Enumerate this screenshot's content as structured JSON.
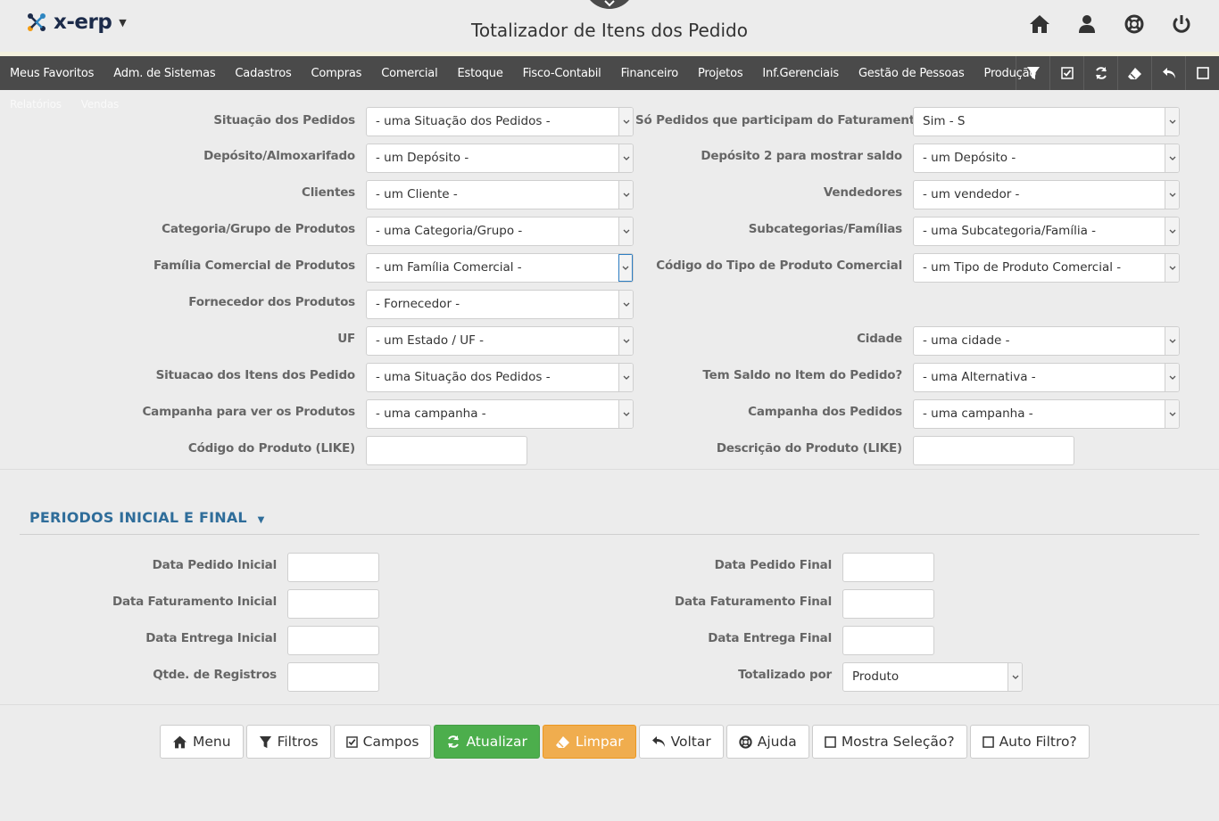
{
  "app": {
    "logo_text": "x-erp",
    "title": "Totalizador de Itens dos Pedido"
  },
  "header_icons": [
    "home-icon",
    "user-icon",
    "help-lifebuoy-icon",
    "power-icon"
  ],
  "menu": {
    "items": [
      "Meus Favoritos",
      "Adm. de Sistemas",
      "Cadastros",
      "Compras",
      "Comercial",
      "Estoque",
      "Fisco-Contabil",
      "Financeiro",
      "Projetos",
      "Inf.Gerenciais",
      "Gestão de Pessoas",
      "Produção"
    ],
    "row2": [
      "Relatórios",
      "Vendas"
    ],
    "tools": [
      "filter-icon",
      "checkbox-icon",
      "refresh-icon",
      "eraser-icon",
      "undo-icon",
      "square-icon"
    ]
  },
  "filters": {
    "situacao_pedidos": {
      "label": "Situação dos Pedidos",
      "value": "- uma Situação dos Pedidos -"
    },
    "so_pedidos_faturamento": {
      "label": "Só Pedidos que participam do Faturamento?",
      "value": "Sim - S"
    },
    "deposito": {
      "label": "Depósito/Almoxarifado",
      "value": "- um Depósito -"
    },
    "deposito2": {
      "label": "Depósito 2 para mostrar saldo",
      "value": "- um Depósito -"
    },
    "clientes": {
      "label": "Clientes",
      "value": "- um Cliente -"
    },
    "vendedores": {
      "label": "Vendedores",
      "value": "- um vendedor -"
    },
    "categoria": {
      "label": "Categoria/Grupo de Produtos",
      "value": "- uma Categoria/Grupo -"
    },
    "subcategorias": {
      "label": "Subcategorias/Famílias",
      "value": "- uma Subcategoria/Família -"
    },
    "familia_comercial": {
      "label": "Família Comercial de Produtos",
      "value": "- um Família Comercial -"
    },
    "tipo_produto": {
      "label": "Código do Tipo de Produto Comercial",
      "value": "- um Tipo de Produto Comercial -"
    },
    "fornecedor": {
      "label": "Fornecedor dos Produtos",
      "value": "- Fornecedor -"
    },
    "uf": {
      "label": "UF",
      "value": "- um Estado / UF -"
    },
    "cidade": {
      "label": "Cidade",
      "value": "- uma cidade -"
    },
    "situacao_itens": {
      "label": "Situacao dos Itens dos Pedido",
      "value": "- uma Situação dos Pedidos -"
    },
    "tem_saldo": {
      "label": "Tem Saldo no Item do Pedido?",
      "value": "- uma Alternativa -"
    },
    "campanha_produtos": {
      "label": "Campanha para ver os Produtos",
      "value": "- uma campanha -"
    },
    "campanha_pedidos": {
      "label": "Campanha dos Pedidos",
      "value": "- uma campanha -"
    },
    "codigo_produto": {
      "label": "Código do Produto (LIKE)",
      "value": ""
    },
    "descricao_produto": {
      "label": "Descrição do Produto (LIKE)",
      "value": ""
    }
  },
  "periods": {
    "title": "PERIODOS INICIAL E FINAL",
    "data_pedido_inicial": {
      "label": "Data Pedido Inicial",
      "value": ""
    },
    "data_pedido_final": {
      "label": "Data Pedido Final",
      "value": ""
    },
    "data_fat_inicial": {
      "label": "Data Faturamento Inicial",
      "value": ""
    },
    "data_fat_final": {
      "label": "Data Faturamento Final",
      "value": ""
    },
    "data_entrega_inicial": {
      "label": "Data Entrega Inicial",
      "value": ""
    },
    "data_entrega_final": {
      "label": "Data Entrega Final",
      "value": ""
    },
    "qtde_registros": {
      "label": "Qtde. de Registros",
      "value": ""
    },
    "totalizado_por": {
      "label": "Totalizado por",
      "value": "Produto"
    }
  },
  "buttons": {
    "menu": "Menu",
    "filtros": "Filtros",
    "campos": "Campos",
    "atualizar": "Atualizar",
    "limpar": "Limpar",
    "voltar": "Voltar",
    "ajuda": "Ajuda",
    "mostra_selecao": "Mostra Seleção?",
    "auto_filtro": "Auto Filtro?"
  },
  "colors": {
    "menu_bg": "#4a4a4a",
    "accent_blue": "#2f6d9a",
    "success": "#4cae4c",
    "warning": "#f0ad4e"
  }
}
